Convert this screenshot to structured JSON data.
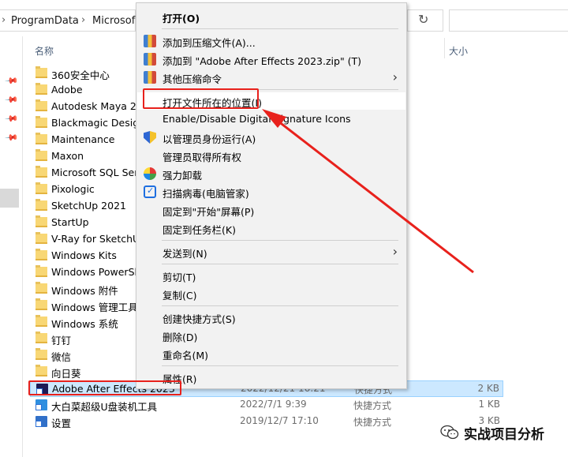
{
  "address_bar": {
    "crumbs": [
      "ProgramData",
      "Microsof"
    ],
    "chevron": "›",
    "refresh_icon": "↻"
  },
  "columns": {
    "name": "名称",
    "size": "大小"
  },
  "files": [
    {
      "name": "360安全中心",
      "type": "folder"
    },
    {
      "name": "Adobe",
      "type": "folder"
    },
    {
      "name": "Autodesk Maya 20",
      "type": "folder"
    },
    {
      "name": "Blackmagic Design",
      "type": "folder"
    },
    {
      "name": "Maintenance",
      "type": "folder"
    },
    {
      "name": "Maxon",
      "type": "folder"
    },
    {
      "name": "Microsoft SQL Ser",
      "type": "folder"
    },
    {
      "name": "Pixologic",
      "type": "folder"
    },
    {
      "name": "SketchUp 2021",
      "type": "folder"
    },
    {
      "name": "StartUp",
      "type": "folder"
    },
    {
      "name": "V-Ray for SketchU",
      "type": "folder"
    },
    {
      "name": "Windows Kits",
      "type": "folder"
    },
    {
      "name": "Windows PowerSh",
      "type": "folder"
    },
    {
      "name": "Windows 附件",
      "type": "folder"
    },
    {
      "name": "Windows 管理工具",
      "type": "folder"
    },
    {
      "name": "Windows 系统",
      "type": "folder"
    },
    {
      "name": "钉钉",
      "type": "folder"
    },
    {
      "name": "微信",
      "type": "folder"
    },
    {
      "name": "向日葵",
      "type": "folder"
    },
    {
      "name": "Adobe After Effects 2023",
      "type": "shortcut",
      "date": "2022/12/21 16:21",
      "kind": "快捷方式",
      "size": "2 KB",
      "selected": true
    },
    {
      "name": "大白菜超级U盘装机工具",
      "type": "shortcut",
      "date": "2022/7/1 9:39",
      "kind": "快捷方式",
      "size": "1 KB"
    },
    {
      "name": "设置",
      "type": "shortcut",
      "date": "2019/12/7 17:10",
      "kind": "快捷方式",
      "size": "3 KB"
    }
  ],
  "context_menu": {
    "open": "打开(O)",
    "add_archive": "添加到压缩文件(A)...",
    "add_to_zip": "添加到 \"Adobe After Effects 2023.zip\" (T)",
    "other_compress": "其他压缩命令",
    "open_location": "打开文件所在的位置(I)",
    "digital_signature": "Enable/Disable Digital Signature Icons",
    "run_as_admin": "以管理员身份运行(A)",
    "take_ownership": "管理员取得所有权",
    "force_uninstall": "强力卸载",
    "virus_scan": "扫描病毒(电脑管家)",
    "pin_start": "固定到\"开始\"屏幕(P)",
    "pin_taskbar": "固定到任务栏(K)",
    "send_to": "发送到(N)",
    "cut": "剪切(T)",
    "copy": "复制(C)",
    "create_shortcut": "创建快捷方式(S)",
    "delete": "删除(D)",
    "rename": "重命名(M)",
    "properties": "属性(R)",
    "submenu_arrow": "›"
  },
  "watermark": {
    "text": "实战项目分析"
  },
  "colors": {
    "annotation_red": "#e8211c",
    "selection_blue": "#cce8ff",
    "menu_bg": "#f2f2f2"
  }
}
